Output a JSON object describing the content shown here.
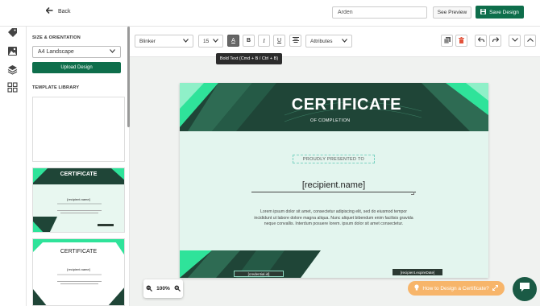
{
  "header": {
    "back_label": "Back",
    "design_name": "Arden",
    "preview_label": "See Preview",
    "save_label": "Save Design"
  },
  "panel": {
    "size_title": "SIZE & ORIENTATION",
    "size_value": "A4 Landscape",
    "upload_label": "Upload Design",
    "library_title": "TEMPLATE LIBRARY",
    "thumbs": [
      {
        "title": "CERTIFICATE",
        "name": "[recipient.name]"
      },
      {
        "title": "CERTIFICATE",
        "name": "[recipient.name]"
      }
    ]
  },
  "toolbar": {
    "font": "Blinker",
    "size": "15",
    "attributes": "Attributes",
    "tooltip": "Bold Text (Cmd + B / Ctrl + B)"
  },
  "certificate": {
    "title": "CERTIFICATE",
    "subtitle": "OF COMPLETION",
    "presented": "PROUDLY PRESENTED TO",
    "recipient": "[recipient.name]",
    "body": "Lorem ipsum dolor sit amet, consectetur adipiscing elit, sed do eiusmod tempor incididunt ut labore dolore magna aliqua. Nunc aliquet bibendum enim facilisis gravida neque convallis. Interdum posuere lorem. ipsum dolor sit amet consectetur.",
    "credential": "[credential.id]",
    "expire": "[recipient.expireDate]"
  },
  "zoom": {
    "level": "100%"
  },
  "help": {
    "label": "How to Design a Certificate?"
  },
  "colors": {
    "brand": "#0e6e4b",
    "dark_green": "#1f4537",
    "bright_green": "#2fe39a",
    "cert_bg": "#e3f5ee",
    "help_orange": "#f7b56a"
  }
}
